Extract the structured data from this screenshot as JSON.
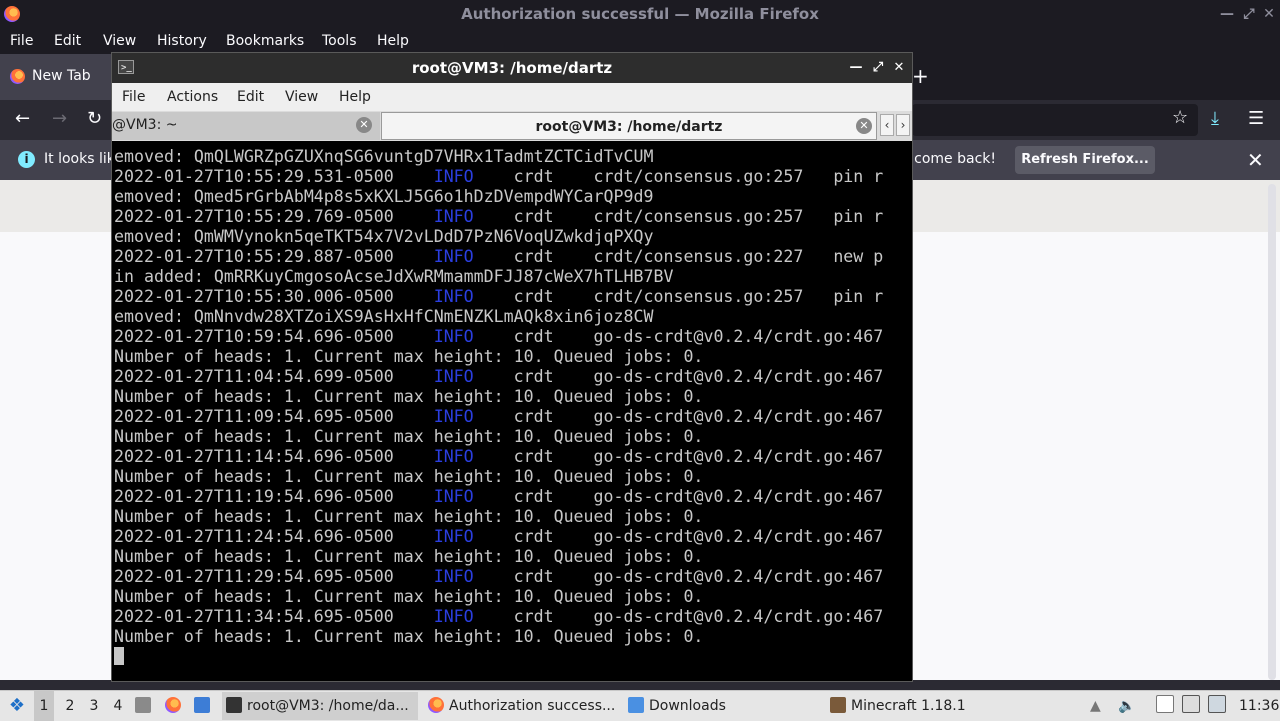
{
  "firefox": {
    "title": "Authorization successful — Mozilla Firefox",
    "menu": [
      "File",
      "Edit",
      "View",
      "History",
      "Bookmarks",
      "Tools",
      "Help"
    ],
    "tab_label": "New Tab",
    "notification_left": "It looks lik",
    "notification_right": "lcome back!",
    "refresh_button": "Refresh Firefox..."
  },
  "terminal": {
    "title": "root@VM3: /home/dartz",
    "menu": [
      "File",
      "Actions",
      "Edit",
      "View",
      "Help"
    ],
    "tabs": [
      "@VM3: ~",
      "root@VM3: /home/dartz"
    ],
    "lines": [
      {
        "text": "emoved: QmQLWGRZpGZUXnqSG6vuntgD7VHRx1TadmtZCTCidTvCUM"
      },
      {
        "pre": "2022-01-27T10:55:29.531-0500    ",
        "info": "INFO",
        "post": "    crdt    crdt/consensus.go:257   pin r"
      },
      {
        "text": "emoved: Qmed5rGrbAbM4p8s5xKXLJ5G6o1hDzDVempdWYCarQP9d9"
      },
      {
        "pre": "2022-01-27T10:55:29.769-0500    ",
        "info": "INFO",
        "post": "    crdt    crdt/consensus.go:257   pin r"
      },
      {
        "text": "emoved: QmWMVynokn5qeTKT54x7V2vLDdD7PzN6VoqUZwkdjqPXQy"
      },
      {
        "pre": "2022-01-27T10:55:29.887-0500    ",
        "info": "INFO",
        "post": "    crdt    crdt/consensus.go:227   new p"
      },
      {
        "text": "in added: QmRRKuyCmgosoAcseJdXwRMmammDFJJ87cWeX7hTLHB7BV"
      },
      {
        "pre": "2022-01-27T10:55:30.006-0500    ",
        "info": "INFO",
        "post": "    crdt    crdt/consensus.go:257   pin r"
      },
      {
        "text": "emoved: QmNnvdw28XTZoiXS9AsHxHfCNmENZKLmAQk8xin6joz8CW"
      },
      {
        "pre": "2022-01-27T10:59:54.696-0500    ",
        "info": "INFO",
        "post": "    crdt    go-ds-crdt@v0.2.4/crdt.go:467"
      },
      {
        "text": "Number of heads: 1. Current max height: 10. Queued jobs: 0."
      },
      {
        "pre": "2022-01-27T11:04:54.699-0500    ",
        "info": "INFO",
        "post": "    crdt    go-ds-crdt@v0.2.4/crdt.go:467"
      },
      {
        "text": "Number of heads: 1. Current max height: 10. Queued jobs: 0."
      },
      {
        "pre": "2022-01-27T11:09:54.695-0500    ",
        "info": "INFO",
        "post": "    crdt    go-ds-crdt@v0.2.4/crdt.go:467"
      },
      {
        "text": "Number of heads: 1. Current max height: 10. Queued jobs: 0."
      },
      {
        "pre": "2022-01-27T11:14:54.696-0500    ",
        "info": "INFO",
        "post": "    crdt    go-ds-crdt@v0.2.4/crdt.go:467"
      },
      {
        "text": "Number of heads: 1. Current max height: 10. Queued jobs: 0."
      },
      {
        "pre": "2022-01-27T11:19:54.696-0500    ",
        "info": "INFO",
        "post": "    crdt    go-ds-crdt@v0.2.4/crdt.go:467"
      },
      {
        "text": "Number of heads: 1. Current max height: 10. Queued jobs: 0."
      },
      {
        "pre": "2022-01-27T11:24:54.696-0500    ",
        "info": "INFO",
        "post": "    crdt    go-ds-crdt@v0.2.4/crdt.go:467"
      },
      {
        "text": "Number of heads: 1. Current max height: 10. Queued jobs: 0."
      },
      {
        "pre": "2022-01-27T11:29:54.695-0500    ",
        "info": "INFO",
        "post": "    crdt    go-ds-crdt@v0.2.4/crdt.go:467"
      },
      {
        "text": "Number of heads: 1. Current max height: 10. Queued jobs: 0."
      },
      {
        "pre": "2022-01-27T11:34:54.695-0500    ",
        "info": "INFO",
        "post": "    crdt    go-ds-crdt@v0.2.4/crdt.go:467"
      },
      {
        "text": "Number of heads: 1. Current max height: 10. Queued jobs: 0."
      }
    ]
  },
  "taskbar": {
    "workspaces": [
      "1",
      "2",
      "3",
      "4"
    ],
    "tasks": [
      "root@VM3: /home/da...",
      "Authorization success...",
      "Downloads",
      "Minecraft 1.18.1"
    ],
    "clock": "11:36"
  },
  "colors": {
    "info": "#2a3ee0",
    "firefox_dark": "#1c1b22"
  }
}
